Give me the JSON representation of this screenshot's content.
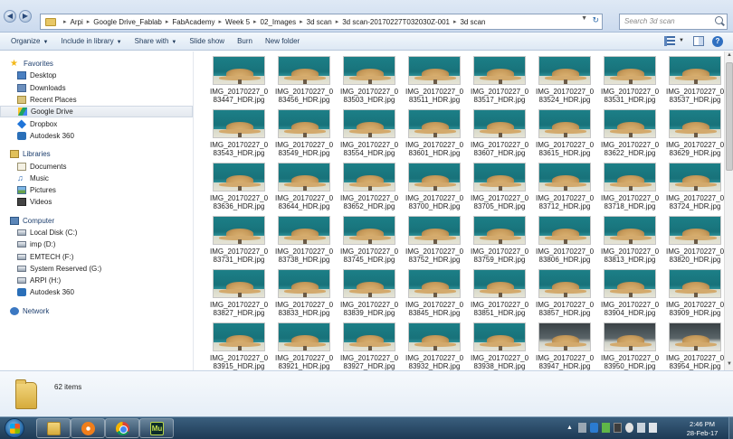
{
  "address": {
    "crumbs": [
      "Arpi",
      "Google Drive_Fablab",
      "FabAcademy",
      "Week 5",
      "02_Images",
      "3d scan",
      "3d scan-20170227T032030Z-001",
      "3d scan"
    ]
  },
  "search": {
    "placeholder": "Search 3d scan"
  },
  "toolbar": {
    "organize": "Organize",
    "include_in_library": "Include in library",
    "share_with": "Share with",
    "slide_show": "Slide show",
    "burn": "Burn",
    "new_folder": "New folder"
  },
  "nav": {
    "favorites": {
      "label": "Favorites",
      "items": [
        "Desktop",
        "Downloads",
        "Recent Places",
        "Google Drive",
        "Dropbox",
        "Autodesk 360"
      ]
    },
    "libraries": {
      "label": "Libraries",
      "items": [
        "Documents",
        "Music",
        "Pictures",
        "Videos"
      ]
    },
    "computer": {
      "label": "Computer",
      "items": [
        "Local Disk (C:)",
        "imp (D:)",
        "EMTECH (F:)",
        "System Reserved (G:)",
        "ARPI (H:)",
        "Autodesk 360"
      ]
    },
    "network": {
      "label": "Network"
    }
  },
  "files": [
    "IMG_20170227_083447_HDR.jpg",
    "IMG_20170227_083456_HDR.jpg",
    "IMG_20170227_083503_HDR.jpg",
    "IMG_20170227_083511_HDR.jpg",
    "IMG_20170227_083517_HDR.jpg",
    "IMG_20170227_083524_HDR.jpg",
    "IMG_20170227_083531_HDR.jpg",
    "IMG_20170227_083537_HDR.jpg",
    "IMG_20170227_083543_HDR.jpg",
    "IMG_20170227_083549_HDR.jpg",
    "IMG_20170227_083554_HDR.jpg",
    "IMG_20170227_083601_HDR.jpg",
    "IMG_20170227_083607_HDR.jpg",
    "IMG_20170227_083615_HDR.jpg",
    "IMG_20170227_083622_HDR.jpg",
    "IMG_20170227_083629_HDR.jpg",
    "IMG_20170227_083636_HDR.jpg",
    "IMG_20170227_083644_HDR.jpg",
    "IMG_20170227_083652_HDR.jpg",
    "IMG_20170227_083700_HDR.jpg",
    "IMG_20170227_083705_HDR.jpg",
    "IMG_20170227_083712_HDR.jpg",
    "IMG_20170227_083718_HDR.jpg",
    "IMG_20170227_083724_HDR.jpg",
    "IMG_20170227_083731_HDR.jpg",
    "IMG_20170227_083738_HDR.jpg",
    "IMG_20170227_083745_HDR.jpg",
    "IMG_20170227_083752_HDR.jpg",
    "IMG_20170227_083759_HDR.jpg",
    "IMG_20170227_083806_HDR.jpg",
    "IMG_20170227_083813_HDR.jpg",
    "IMG_20170227_083820_HDR.jpg",
    "IMG_20170227_083827_HDR.jpg",
    "IMG_20170227_083833_HDR.jpg",
    "IMG_20170227_083839_HDR.jpg",
    "IMG_20170227_083845_HDR.jpg",
    "IMG_20170227_083851_HDR.jpg",
    "IMG_20170227_083857_HDR.jpg",
    "IMG_20170227_083904_HDR.jpg",
    "IMG_20170227_083909_HDR.jpg",
    "IMG_20170227_083915_HDR.jpg",
    "IMG_20170227_083921_HDR.jpg",
    "IMG_20170227_083927_HDR.jpg",
    "IMG_20170227_083932_HDR.jpg",
    "IMG_20170227_083938_HDR.jpg",
    "IMG_20170227_083947_HDR.jpg",
    "IMG_20170227_083950_HDR.jpg",
    "IMG_20170227_083954_HDR.jpg"
  ],
  "status": {
    "item_count": "62 items"
  },
  "taskbar": {
    "apps": [
      {
        "name": "explorer",
        "icon": "folder-icon"
      },
      {
        "name": "media-player",
        "icon": "media-player-icon"
      },
      {
        "name": "chrome",
        "icon": "chrome-icon"
      },
      {
        "name": "muse",
        "icon": "muse-icon",
        "label": "Mu"
      }
    ],
    "time": "2:46 PM",
    "date": "28-Feb-17"
  }
}
